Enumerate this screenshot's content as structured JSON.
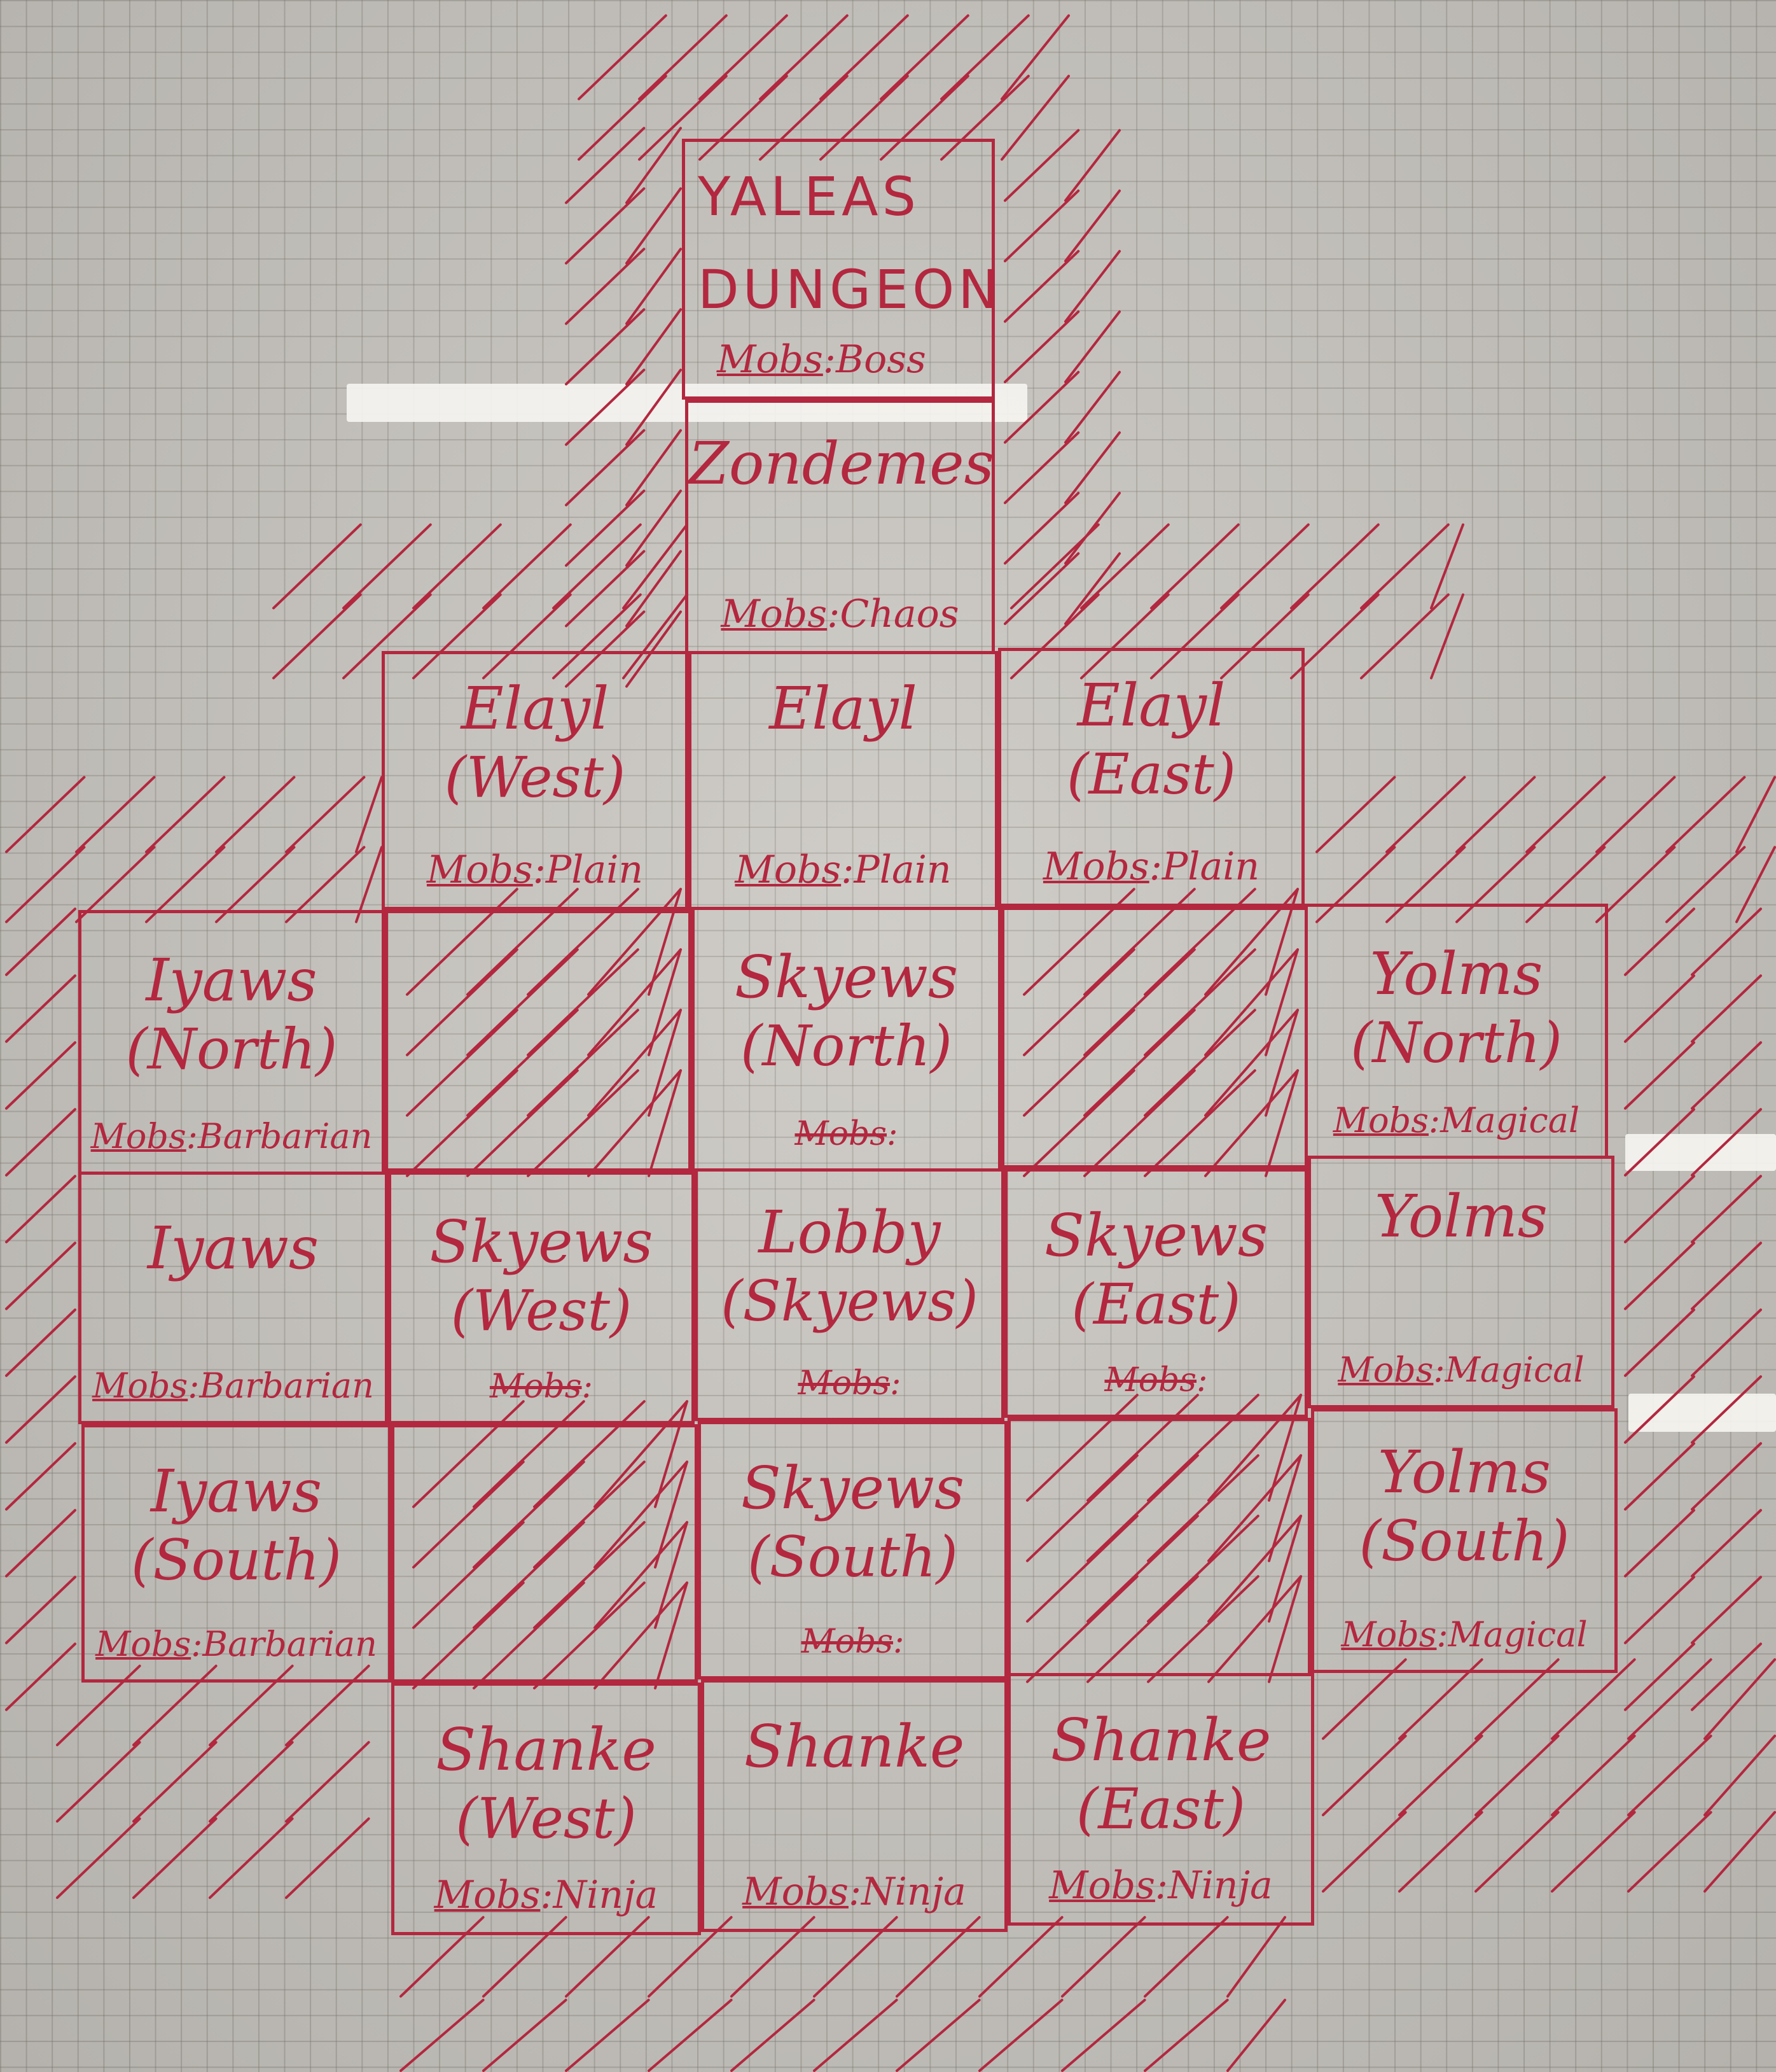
{
  "colors": {
    "ink": "#b3273f",
    "paper": "#c9c6c0",
    "grid": "#8a857e"
  },
  "map": {
    "boss_room": {
      "line1": "YALEAS",
      "line2": "DUNGEON",
      "mobs_label": "Mobs",
      "mobs_value": "Boss"
    },
    "zondemes": {
      "name": "Zondemes",
      "mobs_label": "Mobs",
      "mobs_value": "Chaos"
    },
    "elayl_west": {
      "name": "Elayl",
      "sub": "(West)",
      "mobs_label": "Mobs",
      "mobs_value": "Plain"
    },
    "elayl": {
      "name": "Elayl",
      "mobs_label": "Mobs",
      "mobs_value": "Plain"
    },
    "elayl_east": {
      "name": "Elayl",
      "sub": "(East)",
      "mobs_label": "Mobs",
      "mobs_value": "Plain"
    },
    "iyaws_north": {
      "name": "Iyaws",
      "sub": "(North)",
      "mobs_label": "Mobs",
      "mobs_value": "Barbarian"
    },
    "skyews_north": {
      "name": "Skyews",
      "sub": "(North)",
      "mobs_label": "Mobs",
      "mobs_value": ""
    },
    "yolms_north": {
      "name": "Yolms",
      "sub": "(North)",
      "mobs_label": "Mobs",
      "mobs_value": "Magical"
    },
    "iyaws": {
      "name": "Iyaws",
      "mobs_label": "Mobs",
      "mobs_value": "Barbarian"
    },
    "skyews_west": {
      "name": "Skyews",
      "sub": "(West)",
      "mobs_label": "Mobs",
      "mobs_value": ""
    },
    "lobby": {
      "name": "Lobby",
      "sub": "(Skyews)",
      "mobs_label": "Mobs",
      "mobs_value": ""
    },
    "skyews_east": {
      "name": "Skyews",
      "sub": "(East)",
      "mobs_label": "Mobs",
      "mobs_value": ""
    },
    "yolms": {
      "name": "Yolms",
      "mobs_label": "Mobs",
      "mobs_value": "Magical"
    },
    "iyaws_south": {
      "name": "Iyaws",
      "sub": "(South)",
      "mobs_label": "Mobs",
      "mobs_value": "Barbarian"
    },
    "skyews_south": {
      "name": "Skyews",
      "sub": "(South)",
      "mobs_label": "Mobs",
      "mobs_value": ""
    },
    "yolms_south": {
      "name": "Yolms",
      "sub": "(South)",
      "mobs_label": "Mobs",
      "mobs_value": "Magical"
    },
    "shanke_west": {
      "name": "Shanke",
      "sub": "(West)",
      "mobs_label": "Mobs",
      "mobs_value": "Ninja"
    },
    "shanke": {
      "name": "Shanke",
      "mobs_label": "Mobs",
      "mobs_value": "Ninja"
    },
    "shanke_east": {
      "name": "Shanke",
      "sub": "(East)",
      "mobs_label": "Mobs",
      "mobs_value": "Ninja"
    }
  }
}
